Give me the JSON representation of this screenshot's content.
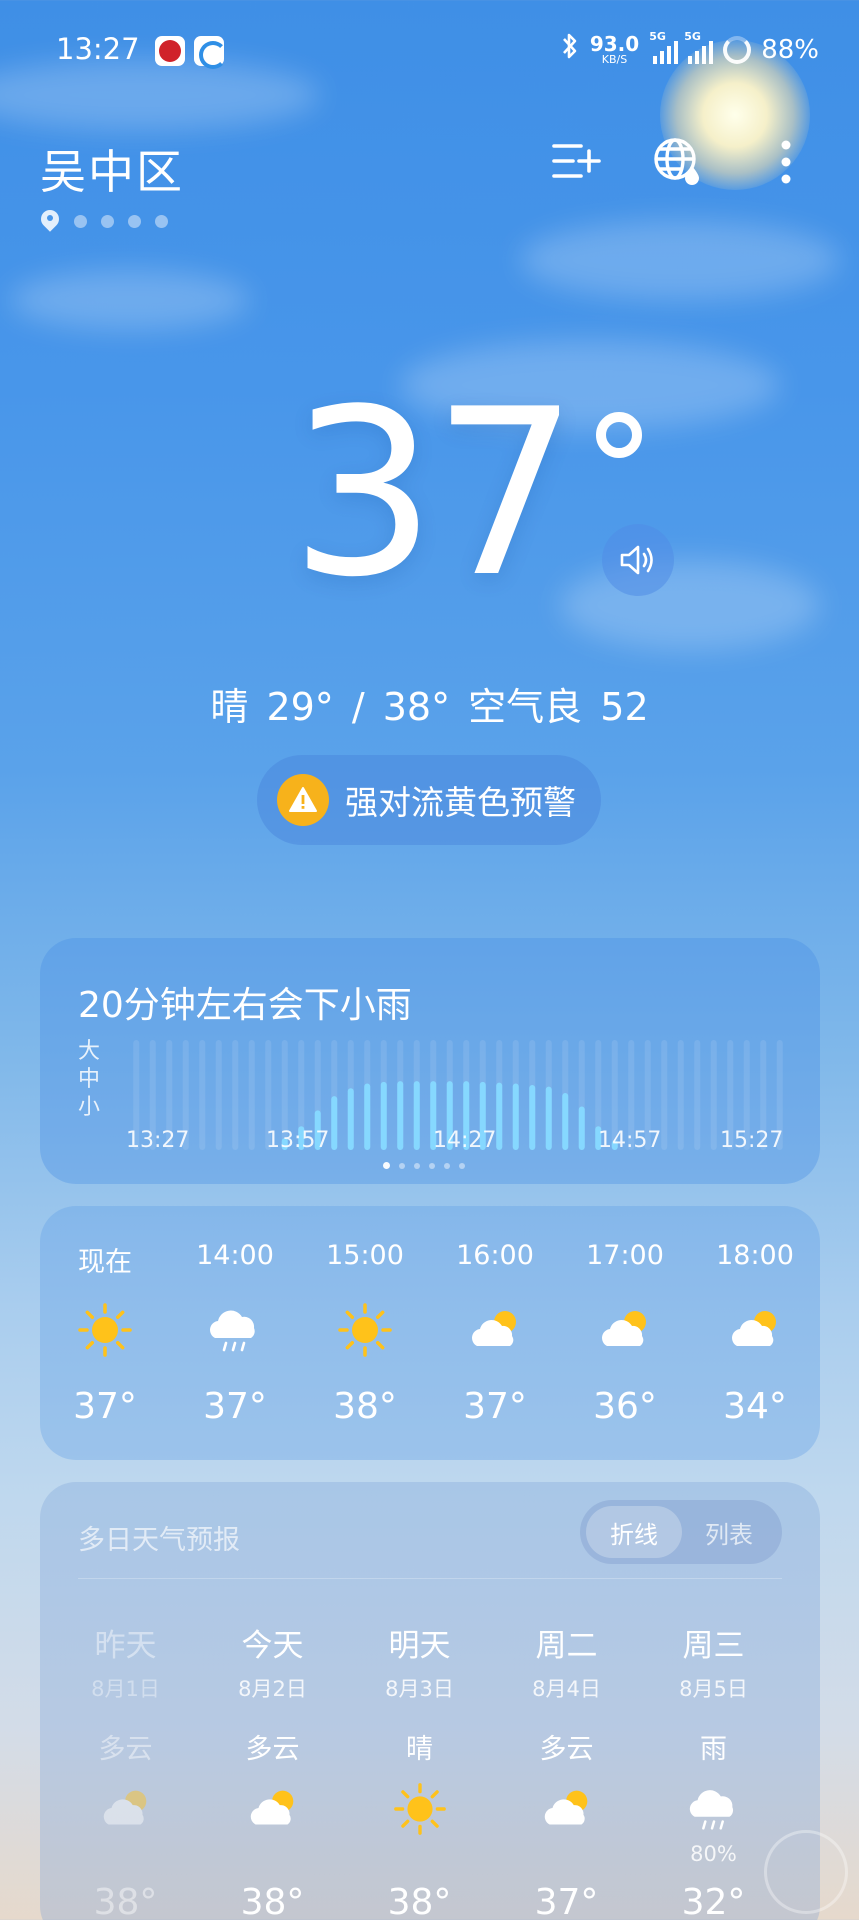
{
  "status_bar": {
    "time": "13:27",
    "net_speed_value": "93.0",
    "net_speed_unit": "KB/S",
    "signal1_label": "5G",
    "signal2_label": "5G",
    "battery": "88%",
    "app_icons": [
      "china-merchants-bank-icon",
      "browser-app-icon"
    ]
  },
  "header": {
    "location": "吴中区",
    "page_count": 5,
    "icons": [
      "add-city-icon",
      "globe-icon",
      "more-icon"
    ]
  },
  "current": {
    "temperature": "37",
    "summary": "晴  29° / 38°  空气良 52",
    "alert": "强对流黄色预警"
  },
  "precipitation": {
    "title": "20分钟左右会下小雨",
    "levels": [
      "大",
      "中",
      "小"
    ],
    "times": [
      "13:27",
      "13:57",
      "14:27",
      "14:57",
      "15:27"
    ],
    "intensity": [
      0,
      0,
      0,
      0,
      0,
      0,
      0,
      0,
      0,
      0.15,
      0.3,
      0.5,
      0.68,
      0.78,
      0.84,
      0.86,
      0.87,
      0.87,
      0.87,
      0.87,
      0.87,
      0.86,
      0.85,
      0.84,
      0.82,
      0.8,
      0.72,
      0.55,
      0.3,
      0.12,
      0,
      0,
      0,
      0,
      0,
      0,
      0,
      0,
      0,
      0
    ],
    "bar_color": "#86d8ff"
  },
  "hourly": [
    {
      "label": "现在",
      "icon": "sun",
      "temp": "37°"
    },
    {
      "label": "14:00",
      "icon": "rain",
      "temp": "37°"
    },
    {
      "label": "15:00",
      "icon": "sun",
      "temp": "38°"
    },
    {
      "label": "16:00",
      "icon": "partly-cloudy",
      "temp": "37°"
    },
    {
      "label": "17:00",
      "icon": "partly-cloudy",
      "temp": "36°"
    },
    {
      "label": "18:00",
      "icon": "partly-cloudy",
      "temp": "34°"
    }
  ],
  "daily": {
    "title": "多日天气预报",
    "toggle_active": "折线",
    "toggle_inactive": "列表",
    "days": [
      {
        "name": "昨天",
        "date": "8月1日",
        "cond": "多云",
        "icon": "partly-cloudy",
        "prob": "",
        "temp": "38°",
        "past": true
      },
      {
        "name": "今天",
        "date": "8月2日",
        "cond": "多云",
        "icon": "partly-cloudy",
        "prob": "",
        "temp": "38°",
        "past": false
      },
      {
        "name": "明天",
        "date": "8月3日",
        "cond": "晴",
        "icon": "sun",
        "prob": "",
        "temp": "38°",
        "past": false
      },
      {
        "name": "周二",
        "date": "8月4日",
        "cond": "多云",
        "icon": "partly-cloudy",
        "prob": "",
        "temp": "37°",
        "past": false
      },
      {
        "name": "周三",
        "date": "8月5日",
        "cond": "雨",
        "icon": "rain",
        "prob": "80%",
        "temp": "32°",
        "past": false
      }
    ]
  },
  "colors": {
    "sun": "#ffc21a",
    "alert": "#f7b21b"
  }
}
